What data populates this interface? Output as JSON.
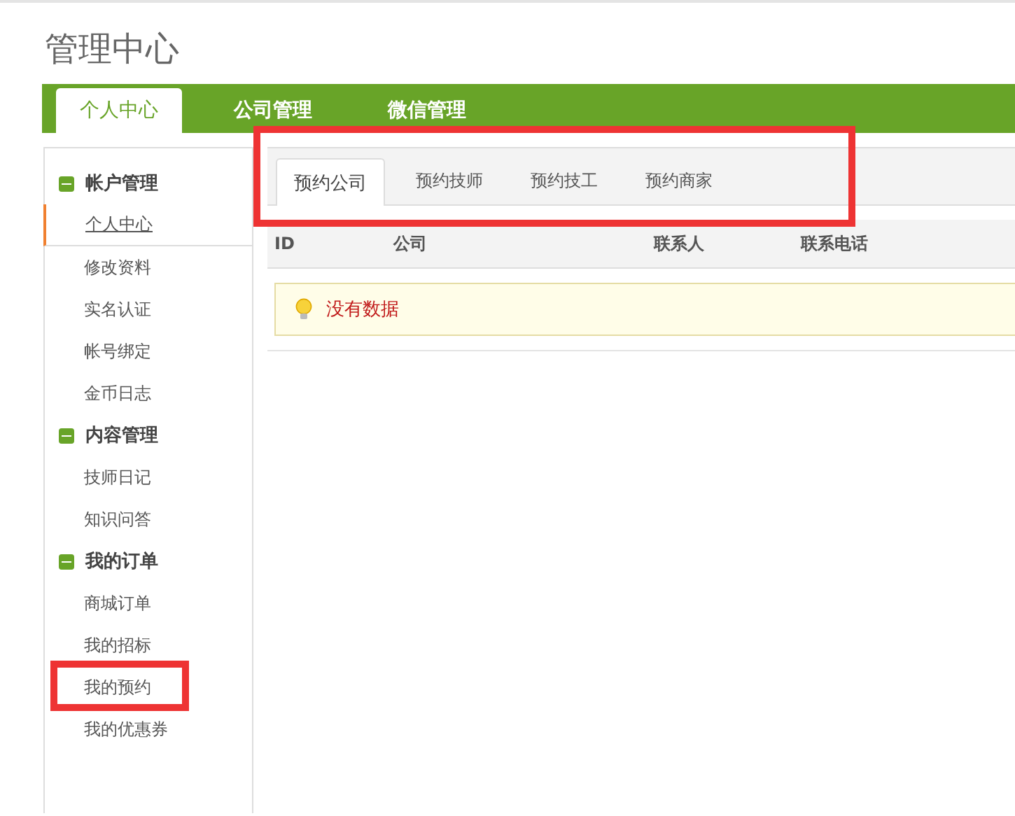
{
  "page_title": "管理中心",
  "nav_tabs": [
    {
      "label": "个人中心",
      "selected": true
    },
    {
      "label": "公司管理",
      "selected": false
    },
    {
      "label": "微信管理",
      "selected": false
    }
  ],
  "sidebar": {
    "groups": [
      {
        "title": "帐户管理",
        "expanded": true,
        "items": [
          {
            "label": "个人中心",
            "selected": true,
            "highlighted": false
          },
          {
            "label": "修改资料",
            "selected": false,
            "highlighted": false
          },
          {
            "label": "实名认证",
            "selected": false,
            "highlighted": false
          },
          {
            "label": "帐号绑定",
            "selected": false,
            "highlighted": false
          },
          {
            "label": "金币日志",
            "selected": false,
            "highlighted": false
          }
        ]
      },
      {
        "title": "内容管理",
        "expanded": true,
        "items": [
          {
            "label": "技师日记",
            "selected": false,
            "highlighted": false
          },
          {
            "label": "知识问答",
            "selected": false,
            "highlighted": false
          }
        ]
      },
      {
        "title": "我的订单",
        "expanded": true,
        "items": [
          {
            "label": "商城订单",
            "selected": false,
            "highlighted": false
          },
          {
            "label": "我的招标",
            "selected": false,
            "highlighted": false
          },
          {
            "label": "我的预约",
            "selected": false,
            "highlighted": true
          },
          {
            "label": "我的优惠券",
            "selected": false,
            "highlighted": false
          }
        ]
      }
    ]
  },
  "content": {
    "tabs_highlighted": true,
    "tabs": [
      {
        "label": "预约公司",
        "selected": true
      },
      {
        "label": "预约技师",
        "selected": false
      },
      {
        "label": "预约技工",
        "selected": false
      },
      {
        "label": "预约商家",
        "selected": false
      }
    ],
    "table": {
      "columns": [
        "ID",
        "公司",
        "联系人",
        "联系电话"
      ]
    },
    "empty_message": "没有数据"
  }
}
